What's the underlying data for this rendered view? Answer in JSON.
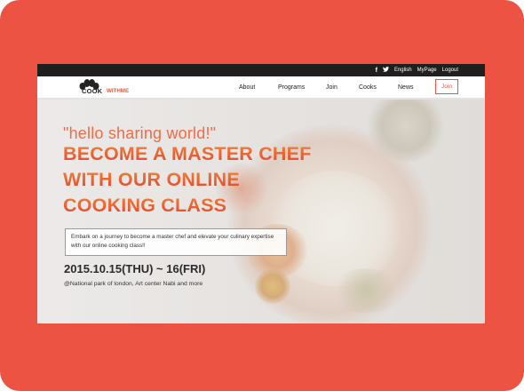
{
  "topbar": {
    "facebook_icon": "f",
    "twitter_icon": "✦",
    "language": "English",
    "mypage": "MyPage",
    "logout": "Logout"
  },
  "logo": {
    "part1": "COOK",
    "part2": "WITHME"
  },
  "nav": {
    "items": [
      "About",
      "Programs",
      "Join",
      "Cooks",
      "News"
    ],
    "join_button": "Join"
  },
  "hero": {
    "tagline": "\"hello sharing world!\"",
    "headline": [
      "BECOME A MASTER CHEF",
      "WITH OUR ONLINE",
      "COOKING CLASS"
    ],
    "description": "Embark on a journey to become a master chef and elevate your culinary expertise with our online cooking class!!",
    "date": "2015.10.15(THU) ~ 16(FRI)",
    "location": "@National park of london, Art center Nabi and more"
  },
  "colors": {
    "frame": "#ec5343",
    "accent": "#ec5a3c",
    "topbar": "#1f1f1f"
  }
}
